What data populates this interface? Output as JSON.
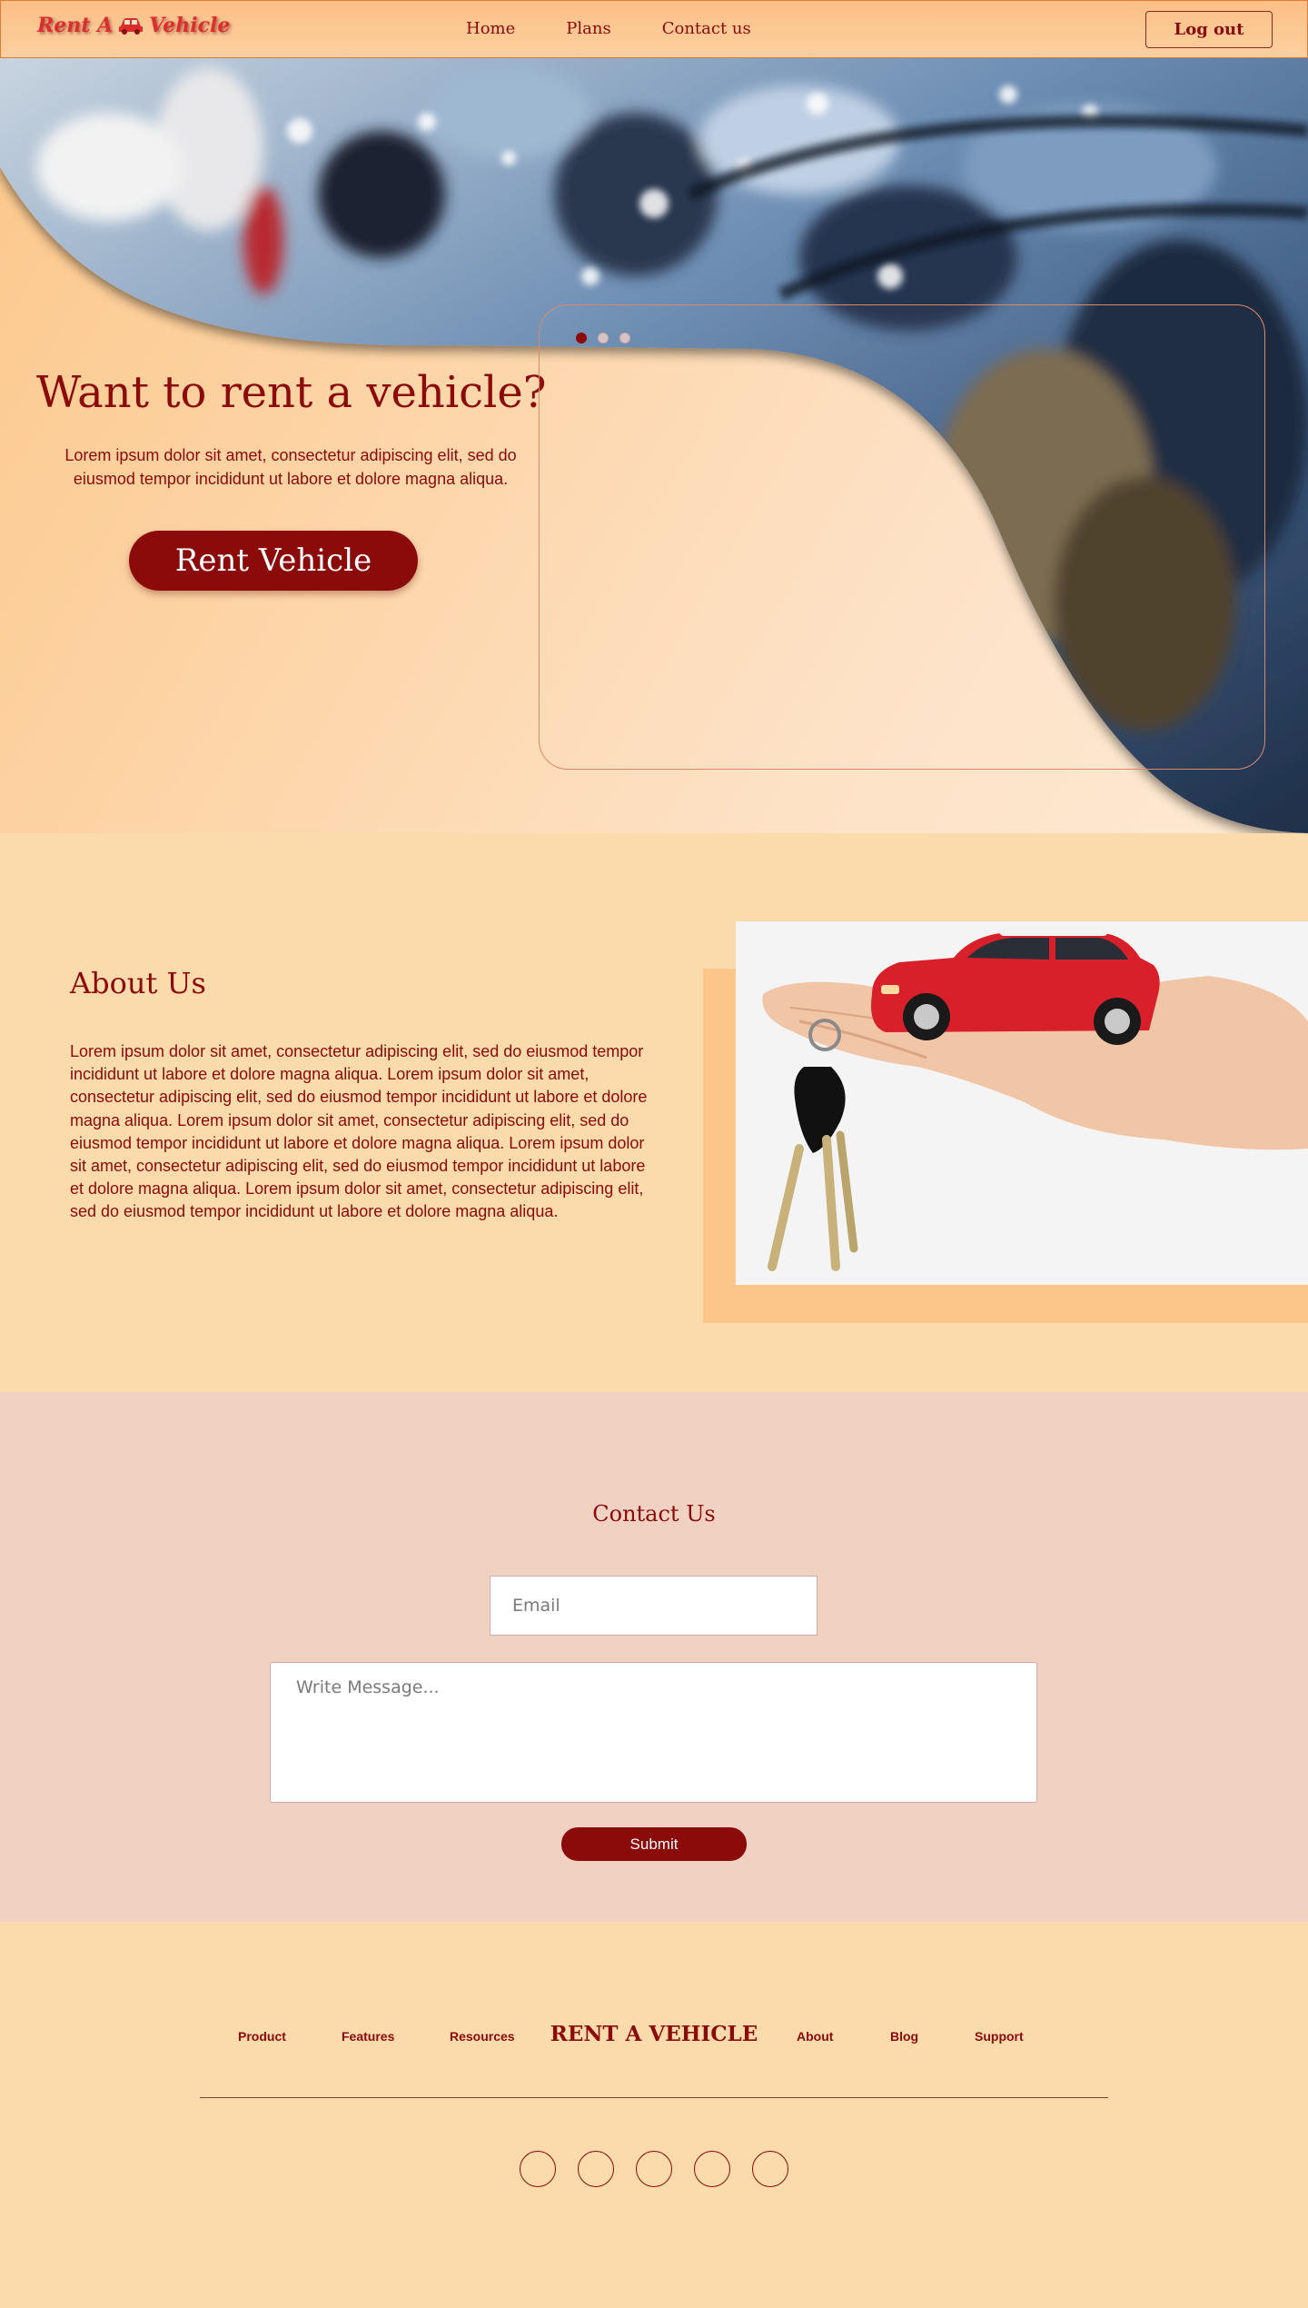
{
  "brand": {
    "logo_text_left": "Rent A",
    "logo_text_right": "Vehicle",
    "logo_icon": "car-icon"
  },
  "nav": {
    "links": [
      "Home",
      "Plans",
      "Contact us"
    ],
    "logout_label": "Log out"
  },
  "hero": {
    "title": "Want to rent a vehicle?",
    "text": "Lorem ipsum dolor sit amet, consectetur adipiscing elit, sed do eiusmod tempor incididunt ut labore et dolore magna aliqua.",
    "cta_label": "Rent Vehicle",
    "carousel_active_index": 0,
    "carousel_slide_count": 3
  },
  "about": {
    "title": "About Us",
    "text": "Lorem ipsum dolor sit amet, consectetur adipiscing elit, sed do eiusmod tempor incididunt ut labore et dolore magna aliqua. Lorem ipsum dolor sit amet, consectetur adipiscing elit, sed do eiusmod tempor incididunt ut labore et dolore magna aliqua. Lorem ipsum dolor sit amet, consectetur adipiscing elit, sed do eiusmod tempor incididunt ut labore et dolore magna aliqua. Lorem ipsum dolor sit amet, consectetur adipiscing elit, sed do eiusmod tempor incididunt ut labore et dolore magna aliqua. Lorem ipsum dolor sit amet, consectetur adipiscing elit, sed do eiusmod tempor incididunt ut labore et dolore magna aliqua."
  },
  "contact": {
    "title": "Contact Us",
    "email_placeholder": "Email",
    "message_placeholder": "Write Message...",
    "submit_label": "Submit"
  },
  "footer": {
    "links_left": [
      "Product",
      "Features",
      "Resources"
    ],
    "brand": "RENT A VEHICLE",
    "links_right": [
      "About",
      "Blog",
      "Support"
    ],
    "social_count": 5
  },
  "colors": {
    "primary": "#8b0a0a",
    "page_bg": "#fbdaab",
    "contact_bg": "#f1d1c2",
    "nav_bg": "#fcbf86",
    "logo": "#d9302e"
  }
}
